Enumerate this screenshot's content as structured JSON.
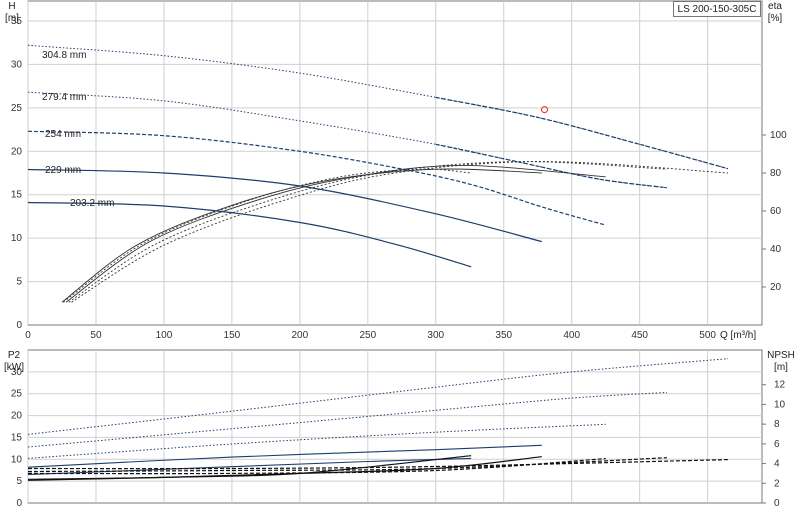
{
  "chart_data": [
    {
      "type": "line",
      "title": "LS 200-150-305C",
      "panel": "head_efficiency",
      "xlabel": "Q [m³/h]",
      "ylabel_left": [
        "H",
        "[m]"
      ],
      "ylabel_right": [
        "eta",
        "[%]"
      ],
      "xlim": [
        0,
        540
      ],
      "ylim": [
        0,
        35
      ],
      "ylim_right": [
        0,
        160
      ],
      "x_ticks": [
        "0",
        "50",
        "100",
        "150",
        "200",
        "250",
        "300",
        "350",
        "400",
        "450",
        "500"
      ],
      "y_ticks": [
        "0",
        "5",
        "10",
        "15",
        "20",
        "25",
        "30",
        "35"
      ],
      "y_right_ticks": [
        "20",
        "40",
        "60",
        "80",
        "100"
      ],
      "grid": true,
      "head_series": [
        {
          "name": "304.8 mm",
          "x": [
            0,
            100,
            200,
            300,
            375,
            450,
            515
          ],
          "y": [
            32.2,
            31.0,
            29.0,
            26.2,
            23.9,
            20.8,
            18.0
          ],
          "solid_until": 0
        },
        {
          "name": "279.4 mm",
          "x": [
            0,
            100,
            200,
            300,
            360,
            420,
            470
          ],
          "y": [
            26.8,
            25.8,
            23.5,
            20.8,
            18.8,
            16.8,
            15.8
          ],
          "solid_until": 0
        },
        {
          "name": "254 mm",
          "x": [
            0,
            100,
            200,
            280,
            330,
            380,
            425
          ],
          "y": [
            22.3,
            21.8,
            20.0,
            17.8,
            16.0,
            13.5,
            11.5
          ],
          "solid_until": 200
        },
        {
          "name": "229 mm",
          "x": [
            0,
            100,
            200,
            300,
            378
          ],
          "y": [
            17.9,
            17.5,
            16.0,
            12.8,
            9.6
          ],
          "solid_until": 378
        },
        {
          "name": "203.2 mm",
          "x": [
            0,
            100,
            200,
            270,
            326
          ],
          "y": [
            14.1,
            13.7,
            11.8,
            9.3,
            6.7
          ],
          "solid_until": 326
        }
      ],
      "efficiency_series": [
        {
          "x": [
            25,
            80,
            150,
            220,
            300,
            378
          ],
          "y": [
            12,
            42,
            63,
            76,
            82,
            80
          ]
        },
        {
          "x": [
            28,
            90,
            170,
            240,
            320,
            425
          ],
          "y": [
            12,
            44,
            66,
            78,
            84,
            78
          ]
        },
        {
          "x": [
            30,
            95,
            180,
            260,
            360,
            470
          ],
          "y": [
            12,
            43,
            66,
            80,
            86,
            82
          ]
        },
        {
          "x": [
            32,
            100,
            190,
            270,
            380,
            515
          ],
          "y": [
            12,
            42,
            66,
            80,
            86,
            80
          ]
        },
        {
          "x": [
            26,
            85,
            160,
            230,
            290,
            326
          ],
          "y": [
            12,
            43,
            65,
            78,
            82,
            80
          ]
        }
      ],
      "operating_point": {
        "x": 380,
        "y": 24.8
      }
    },
    {
      "type": "line",
      "panel": "power_npsh",
      "xlabel": "Q [m³/h]",
      "ylabel_left": [
        "P2",
        "[kW]"
      ],
      "ylabel_right": [
        "NPSH",
        "[m]"
      ],
      "xlim": [
        0,
        540
      ],
      "ylim": [
        0,
        35
      ],
      "ylim_right": [
        0,
        14
      ],
      "y_ticks": [
        "0",
        "5",
        "10",
        "15",
        "20",
        "25",
        "30"
      ],
      "y_right_ticks": [
        "0",
        "2",
        "4",
        "6",
        "8",
        "10",
        "12"
      ],
      "grid": true,
      "p2_series": [
        {
          "name": "304.8 mm",
          "x": [
            0,
            150,
            300,
            400,
            515
          ],
          "y": [
            15.7,
            21.0,
            26.5,
            30.0,
            33.0
          ]
        },
        {
          "name": "279.4 mm",
          "x": [
            0,
            150,
            300,
            400,
            470
          ],
          "y": [
            12.8,
            17.0,
            21.2,
            24.0,
            25.3
          ]
        },
        {
          "name": "254 mm",
          "x": [
            0,
            150,
            300,
            425
          ],
          "y": [
            10.2,
            13.5,
            16.2,
            18.0
          ]
        },
        {
          "name": "229 mm",
          "x": [
            0,
            150,
            300,
            378
          ],
          "y": [
            8.2,
            10.5,
            12.2,
            13.2
          ]
        },
        {
          "name": "203.2 mm",
          "x": [
            0,
            150,
            250,
            326
          ],
          "y": [
            6.5,
            8.3,
            9.5,
            10.2
          ]
        }
      ],
      "npsh_series": [
        {
          "x": [
            0,
            100,
            200,
            300,
            378
          ],
          "y": [
            2.4,
            2.6,
            3.0,
            3.5,
            4.7
          ]
        },
        {
          "x": [
            0,
            100,
            200,
            326
          ],
          "y": [
            2.3,
            2.6,
            3.0,
            4.8
          ]
        },
        {
          "x": [
            0,
            150,
            300,
            425
          ],
          "y": [
            3.0,
            3.0,
            3.3,
            4.5
          ]
        },
        {
          "x": [
            0,
            150,
            300,
            470
          ],
          "y": [
            3.2,
            3.3,
            3.5,
            4.6
          ]
        },
        {
          "x": [
            0,
            150,
            300,
            515
          ],
          "y": [
            3.5,
            3.5,
            3.7,
            4.4
          ]
        }
      ]
    }
  ]
}
